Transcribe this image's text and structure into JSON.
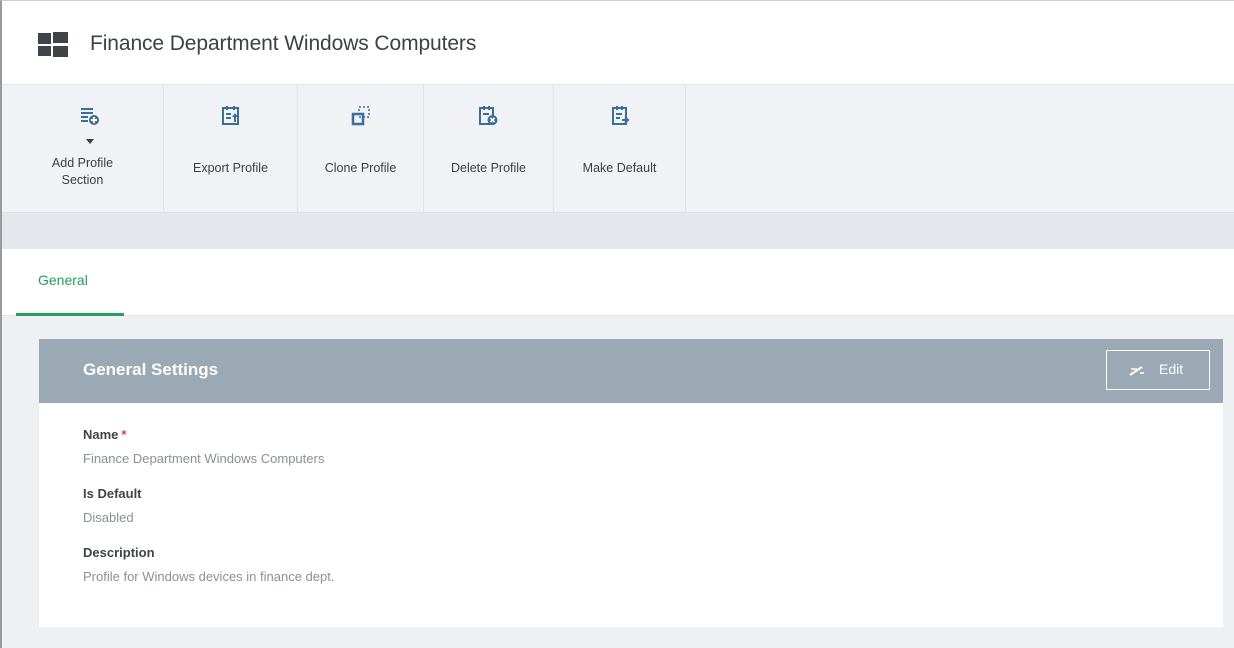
{
  "header": {
    "title": "Finance Department Windows Computers",
    "icon": "windows-logo-icon"
  },
  "toolbar": {
    "items": [
      {
        "label": "Add Profile Section",
        "icon": "add-list-icon"
      },
      {
        "label": "Export Profile",
        "icon": "export-icon"
      },
      {
        "label": "Clone Profile",
        "icon": "clone-icon"
      },
      {
        "label": "Delete Profile",
        "icon": "delete-list-icon"
      },
      {
        "label": "Make Default",
        "icon": "make-default-icon"
      }
    ]
  },
  "tabs": [
    {
      "label": "General",
      "active": true
    }
  ],
  "panel": {
    "title": "General Settings",
    "edit_label": "Edit",
    "fields": [
      {
        "label": "Name",
        "required_mark": "*",
        "value": "Finance Department Windows Computers"
      },
      {
        "label": "Is Default",
        "value": "Disabled"
      },
      {
        "label": "Description",
        "value": "Profile for Windows devices in finance dept."
      }
    ]
  },
  "colors": {
    "accent": "#22a05f",
    "panel_header": "#9aa9b4",
    "required": "#e0443a"
  }
}
